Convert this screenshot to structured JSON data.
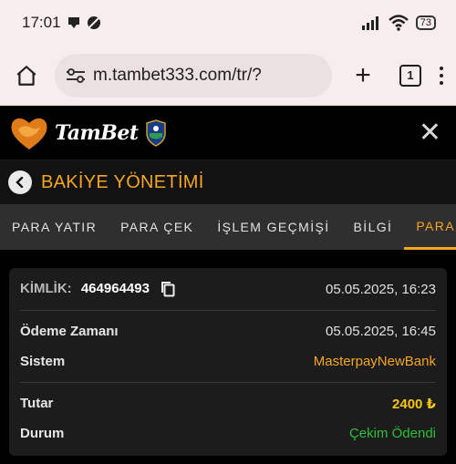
{
  "status_bar": {
    "time": "17:01",
    "battery": "73"
  },
  "browser": {
    "url": "m.tambet333.com/tr/?",
    "tab_count": "1"
  },
  "site": {
    "logo_text": "TamBet"
  },
  "page": {
    "title": "BAKİYE YÖNETİMİ"
  },
  "tabs": [
    {
      "label": "PARA YATIR"
    },
    {
      "label": "PARA ÇEK"
    },
    {
      "label": "İŞLEM GEÇMİŞİ"
    },
    {
      "label": "BİLGİ"
    },
    {
      "label": "PARA ÇEKME"
    }
  ],
  "transaction": {
    "id_label": "KİMLİK:",
    "id_value": "464964493",
    "created": "05.05.2025, 16:23",
    "payment_time_label": "Ödeme Zamanı",
    "payment_time_value": "05.05.2025, 16:45",
    "system_label": "Sistem",
    "system_value": "MasterpayNewBank",
    "amount_label": "Tutar",
    "amount_value": "2400 ₺",
    "status_label": "Durum",
    "status_value": "Çekim Ödendi"
  },
  "colors": {
    "accent": "#f5a623",
    "success": "#2fbf3a",
    "amount": "#f5c518"
  }
}
